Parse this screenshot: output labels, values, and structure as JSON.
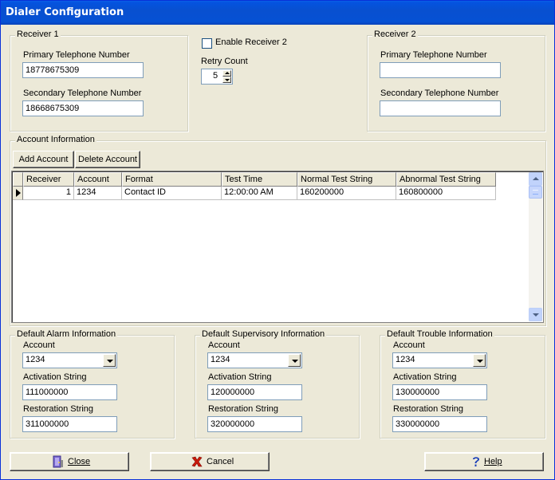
{
  "window": {
    "title": "Dialer Configuration"
  },
  "receiver1": {
    "title": "Receiver 1",
    "primary_label": "Primary Telephone Number",
    "primary_value": "18778675309",
    "secondary_label": "Secondary Telephone Number",
    "secondary_value": "18668675309"
  },
  "enable_receiver2": {
    "label": "Enable Receiver 2",
    "checked": false
  },
  "retry": {
    "label": "Retry Count",
    "value": "5"
  },
  "receiver2": {
    "title": "Receiver 2",
    "primary_label": "Primary Telephone Number",
    "primary_value": "",
    "secondary_label": "Secondary Telephone Number",
    "secondary_value": ""
  },
  "account_info": {
    "title": "Account Information",
    "add_button": "Add Account",
    "delete_button": "Delete Account",
    "columns": [
      "Receiver",
      "Account",
      "Format",
      "Test Time",
      "Normal Test String",
      "Abnormal Test String"
    ],
    "rows": [
      [
        "1",
        "1234",
        "Contact ID",
        "12:00:00 AM",
        "160200000",
        "160800000"
      ]
    ]
  },
  "alarm": {
    "title": "Default Alarm Information",
    "account_label": "Account",
    "account_value": "1234",
    "activation_label": "Activation String",
    "activation_value": "111000000",
    "restoration_label": "Restoration String",
    "restoration_value": "311000000"
  },
  "supervisory": {
    "title": "Default Supervisory Information",
    "account_label": "Account",
    "account_value": "1234",
    "activation_label": "Activation String",
    "activation_value": "120000000",
    "restoration_label": "Restoration String",
    "restoration_value": "320000000"
  },
  "trouble": {
    "title": "Default Trouble Information",
    "account_label": "Account",
    "account_value": "1234",
    "activation_label": "Activation String",
    "activation_value": "130000000",
    "restoration_label": "Restoration String",
    "restoration_value": "330000000"
  },
  "footer": {
    "close_label": "Close",
    "cancel_label": "Cancel",
    "help_label": "Help"
  },
  "icons": {
    "close": "door-icon",
    "cancel": "red-x-icon",
    "help": "question-mark-icon"
  }
}
